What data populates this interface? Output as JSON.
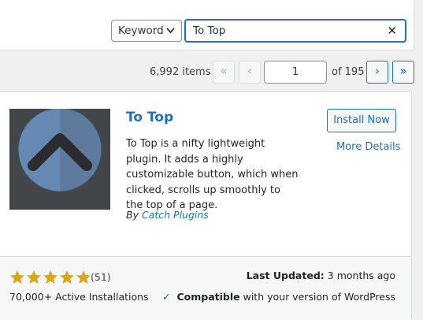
{
  "search": {
    "type_label": "Keyword",
    "query": "To Top"
  },
  "pagination": {
    "items": "6,992 items",
    "first": "«",
    "prev": "‹",
    "current_page": "1",
    "of_label": "of 195",
    "next": "›",
    "last": "»"
  },
  "plugin": {
    "name": "To Top",
    "install_label": "Install Now",
    "more_details_label": "More Details",
    "description": "To Top is a nifty lightweight plugin. It adds a highly customizable button, which when clicked, scrolls up smoothly to the top of a page.",
    "author_prefix": "By",
    "author": "Catch Plugins",
    "rating_stars": 5,
    "rating_count": "(51)",
    "active_installs": "70,000+ Active Installations",
    "last_updated_label": "Last Updated:",
    "last_updated_value": "3 months ago",
    "compat_strong": "Compatible",
    "compat_rest": "with your version of WordPress"
  },
  "colors": {
    "accent": "#2271b1",
    "star": "#dba617",
    "check": "#008a20"
  }
}
